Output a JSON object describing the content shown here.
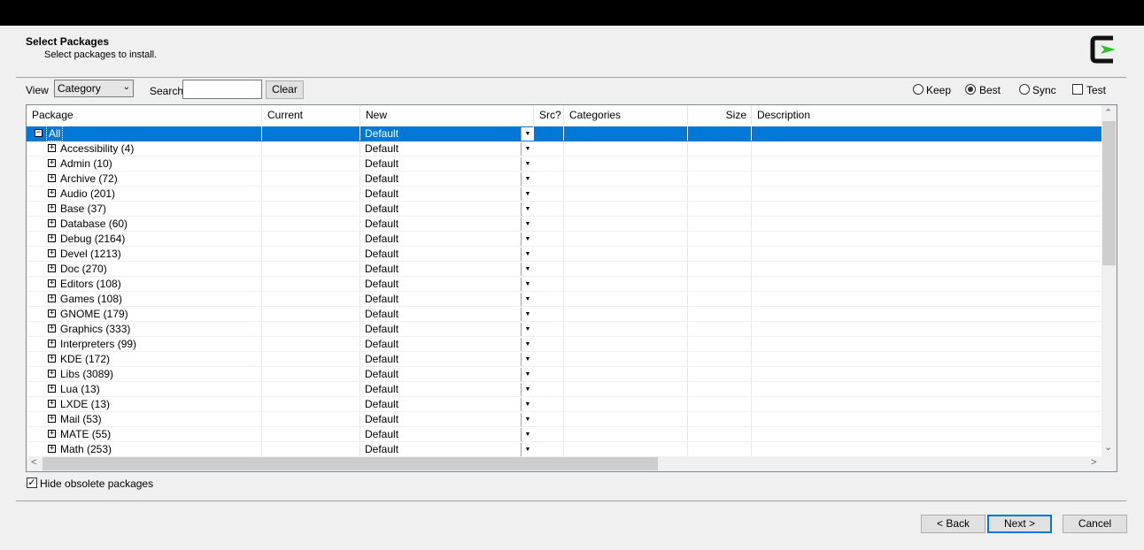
{
  "header": {
    "title": "Select Packages",
    "subtitle": "Select packages to install."
  },
  "toolbar": {
    "view_label": "View",
    "view_value": "Category",
    "search_label": "Search",
    "search_value": "",
    "clear_label": "Clear",
    "modes": [
      {
        "label": "Keep",
        "selected": false
      },
      {
        "label": "Best",
        "selected": true
      },
      {
        "label": "Sync",
        "selected": false
      }
    ],
    "test_label": "Test",
    "test_checked": false
  },
  "table": {
    "columns": [
      "Package",
      "Current",
      "New",
      "Src?",
      "Categories",
      "Size",
      "Description"
    ],
    "rows": [
      {
        "package": "All",
        "expander": "−",
        "new": "Default",
        "selected": true,
        "level": 0
      },
      {
        "package": "Accessibility (4)",
        "expander": "+",
        "new": "Default",
        "level": 1
      },
      {
        "package": "Admin (10)",
        "expander": "+",
        "new": "Default",
        "level": 1
      },
      {
        "package": "Archive (72)",
        "expander": "+",
        "new": "Default",
        "level": 1
      },
      {
        "package": "Audio (201)",
        "expander": "+",
        "new": "Default",
        "level": 1
      },
      {
        "package": "Base (37)",
        "expander": "+",
        "new": "Default",
        "level": 1
      },
      {
        "package": "Database (60)",
        "expander": "+",
        "new": "Default",
        "level": 1
      },
      {
        "package": "Debug (2164)",
        "expander": "+",
        "new": "Default",
        "level": 1
      },
      {
        "package": "Devel (1213)",
        "expander": "+",
        "new": "Default",
        "level": 1
      },
      {
        "package": "Doc (270)",
        "expander": "+",
        "new": "Default",
        "level": 1
      },
      {
        "package": "Editors (108)",
        "expander": "+",
        "new": "Default",
        "level": 1
      },
      {
        "package": "Games (108)",
        "expander": "+",
        "new": "Default",
        "level": 1
      },
      {
        "package": "GNOME (179)",
        "expander": "+",
        "new": "Default",
        "level": 1
      },
      {
        "package": "Graphics (333)",
        "expander": "+",
        "new": "Default",
        "level": 1
      },
      {
        "package": "Interpreters (99)",
        "expander": "+",
        "new": "Default",
        "level": 1
      },
      {
        "package": "KDE (172)",
        "expander": "+",
        "new": "Default",
        "level": 1
      },
      {
        "package": "Libs (3089)",
        "expander": "+",
        "new": "Default",
        "level": 1
      },
      {
        "package": "Lua (13)",
        "expander": "+",
        "new": "Default",
        "level": 1
      },
      {
        "package": "LXDE (13)",
        "expander": "+",
        "new": "Default",
        "level": 1
      },
      {
        "package": "Mail (53)",
        "expander": "+",
        "new": "Default",
        "level": 1
      },
      {
        "package": "MATE (55)",
        "expander": "+",
        "new": "Default",
        "level": 1
      },
      {
        "package": "Math (253)",
        "expander": "+",
        "new": "Default",
        "level": 1
      }
    ]
  },
  "footer": {
    "hide_obsolete_label": "Hide obsolete packages",
    "hide_obsolete_checked": true,
    "back_label": "< Back",
    "next_label": "Next >",
    "cancel_label": "Cancel"
  },
  "colors": {
    "selection": "#0078d7",
    "dialog_bg": "#f0f0f0",
    "logo_green": "#2ec12e"
  }
}
